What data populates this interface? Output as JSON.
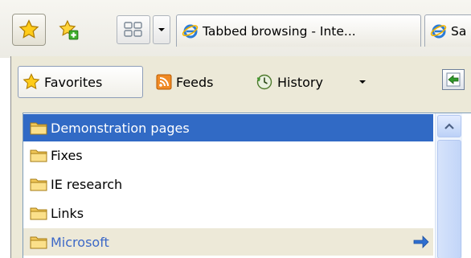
{
  "tabbar": {
    "favorites_center_icon": "favorites-star-icon",
    "add_favorite_icon": "add-to-favorites-icon",
    "quick_tabs_icon": "quick-tabs-icon",
    "tab_list_icon": "chevron-down-icon",
    "tabs": [
      {
        "label": "Tabbed browsing - Inte...",
        "icon": "internet-explorer-icon"
      },
      {
        "label": "Sa",
        "icon": "internet-explorer-icon"
      }
    ]
  },
  "favorites_center": {
    "toolbar": {
      "favorites_label": "Favorites",
      "feeds_label": "Feeds",
      "history_label": "History",
      "history_dropdown_icon": "triangle-down-icon",
      "pin_icon": "pin-panel-icon"
    },
    "items": [
      {
        "label": "Demonstration pages",
        "state": "selected",
        "icon": "folder-icon"
      },
      {
        "label": "Fixes",
        "state": "normal",
        "icon": "folder-icon"
      },
      {
        "label": "IE research",
        "state": "normal",
        "icon": "folder-icon"
      },
      {
        "label": "Links",
        "state": "normal",
        "icon": "folder-icon"
      },
      {
        "label": "Microsoft",
        "state": "hover",
        "icon": "folder-icon",
        "action_icon": "go-arrow-icon"
      }
    ]
  },
  "colors": {
    "selection": "#316ac5",
    "hover_text": "#3c68c7",
    "hover_row": "#ede9d8",
    "panel_bg": "#ece9d8"
  }
}
